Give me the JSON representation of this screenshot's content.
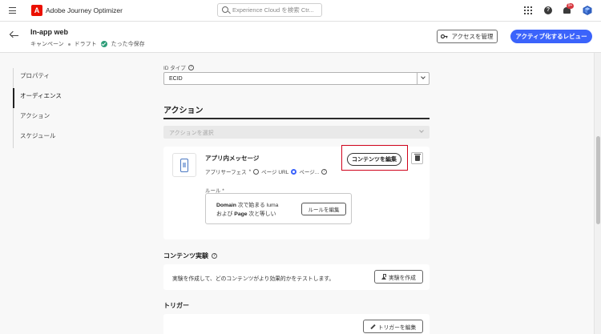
{
  "shell": {
    "app_name": "Adobe Journey Optimizer",
    "search_placeholder": "Experience Cloud を検索 Ctr...",
    "notification_count": "9+"
  },
  "header": {
    "title": "In-app web",
    "type": "キャンペーン",
    "status": "ドラフト",
    "save_state": "たった今保存",
    "manage_access": "アクセスを管理",
    "activate_review": "アクティブ化するレビュー"
  },
  "nav": {
    "items": [
      {
        "label": "プロパティ",
        "selected": false
      },
      {
        "label": "オーディエンス",
        "selected": true
      },
      {
        "label": "アクション",
        "selected": false
      },
      {
        "label": "スケジュール",
        "selected": false
      }
    ]
  },
  "identity": {
    "label": "ID タイプ",
    "value": "ECID"
  },
  "action": {
    "heading": "アクション",
    "select_placeholder": "アクションを選択",
    "message": {
      "title": "アプリ内メッセージ",
      "surface_label": "アプリサーフェス",
      "option_page_url": "ページ URL",
      "option_page": "ページ...",
      "selected_option": "ページ...",
      "edit_content": "コンテンツを編集",
      "rule_label": "ルール *",
      "rule_line1_bold": "Domain",
      "rule_line1_rest": " 次で始まる luma",
      "rule_line2_pre": "および ",
      "rule_line2_bold": "Page",
      "rule_line2_rest": " 次と等しい",
      "edit_rule": "ルールを編集"
    }
  },
  "experiment": {
    "heading": "コンテンツ実験",
    "description": "実験を作成して、どのコンテンツがより効果的かをテストします。",
    "create_button": "実験を作成"
  },
  "trigger": {
    "heading": "トリガー",
    "edit_button": "トリガーを編集"
  },
  "colors": {
    "accent": "#3b63fb",
    "brand": "#eb1000",
    "highlight_box": "#d0021b",
    "saved_check": "#2d9d78"
  }
}
